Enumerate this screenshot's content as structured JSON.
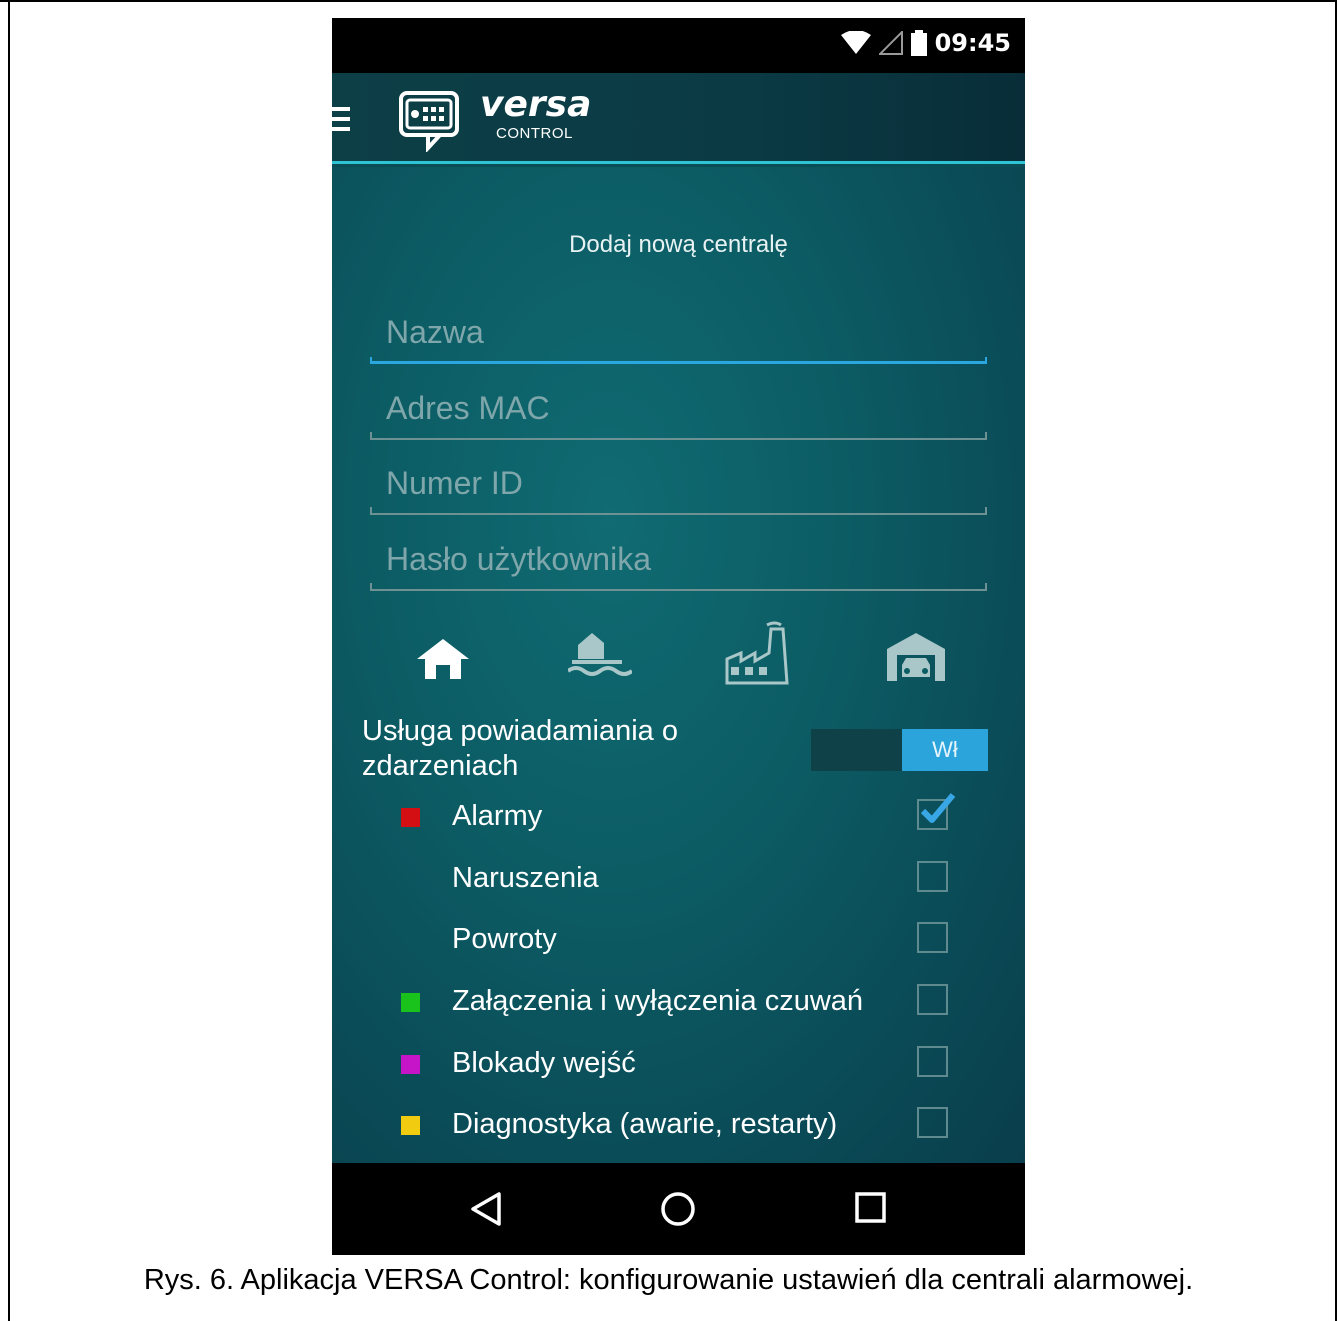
{
  "status_bar": {
    "time": "09:45",
    "icons": [
      "wifi-icon",
      "signal-icon",
      "battery-icon"
    ]
  },
  "app_bar": {
    "menu_icon": "menu-icon",
    "logo_icon": "keypad-logo-icon",
    "brand_name": "versa",
    "brand_sub": "CONTROL"
  },
  "form": {
    "title": "Dodaj nową centralę",
    "fields": [
      {
        "placeholder": "Nazwa",
        "value": ""
      },
      {
        "placeholder": "Adres MAC",
        "value": ""
      },
      {
        "placeholder": "Numer ID",
        "value": ""
      },
      {
        "placeholder": "Hasło użytkownika",
        "value": ""
      }
    ],
    "object_types": [
      "house-icon",
      "lake-house-icon",
      "factory-icon",
      "garage-icon"
    ],
    "selected_type": "house-icon"
  },
  "notifications": {
    "label": "Usługa powiadamiania o zdarzeniach",
    "toggle_label": "Wł",
    "toggle_on": true,
    "events": [
      {
        "label": "Alarmy",
        "color": "#d40f14",
        "checked": true
      },
      {
        "label": "Naruszenia",
        "color": "",
        "checked": false
      },
      {
        "label": "Powroty",
        "color": "",
        "checked": false
      },
      {
        "label": "Załączenia i wyłączenia czuwań",
        "color": "#19c31c",
        "checked": false
      },
      {
        "label": "Blokady wejść",
        "color": "#c614c8",
        "checked": false
      },
      {
        "label": "Diagnostyka (awarie, restarty)",
        "color": "#f0cb10",
        "checked": false
      }
    ]
  },
  "nav_bar": {
    "buttons": [
      "back-icon",
      "home-icon",
      "recents-icon"
    ]
  },
  "caption": "Rys. 6. Aplikacja VERSA Control: konfigurowanie ustawień dla centrali alarmowej.",
  "colors": {
    "accent": "#2aa4db",
    "app_bar_border": "#2ec4d6",
    "background": "#0c5c64"
  }
}
